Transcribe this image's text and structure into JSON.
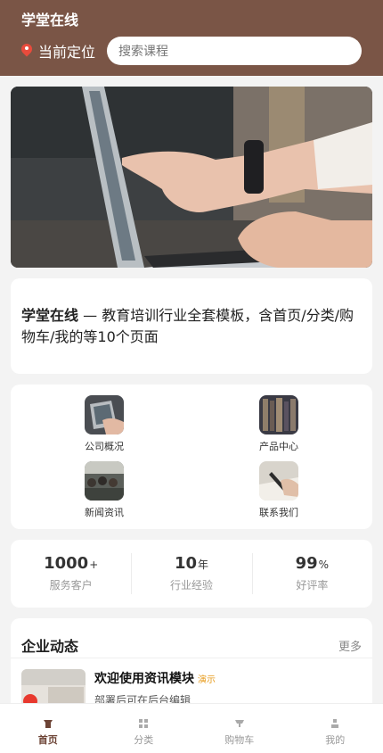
{
  "header": {
    "title": "学堂在线",
    "location_label": "当前定位",
    "search_placeholder": "搜索课程"
  },
  "banner": {
    "icon": "banner-photo-laptop-hands"
  },
  "intro": {
    "brand": "学堂在线",
    "text": " — 教育培训行业全套模板，含首页/分类/购物车/我的等10个页面"
  },
  "grid": {
    "items": [
      {
        "label": "公司概况",
        "icon": "company-overview-icon"
      },
      {
        "label": "产品中心",
        "icon": "product-center-icon"
      },
      {
        "label": "新闻资讯",
        "icon": "news-icon"
      },
      {
        "label": "联系我们",
        "icon": "contact-us-icon"
      }
    ]
  },
  "stats": [
    {
      "num": "1000",
      "unit": "+",
      "label": "服务客户"
    },
    {
      "num": "10",
      "unit": "年",
      "label": "行业经验"
    },
    {
      "num": "99",
      "unit": "%",
      "label": "好评率"
    }
  ],
  "news": {
    "title": "企业动态",
    "more": "更多",
    "item": {
      "title": "欢迎使用资讯模块",
      "tag": "演示",
      "desc": "部署后可在后台编辑"
    }
  },
  "tabs": [
    {
      "label": "首页",
      "active": true
    },
    {
      "label": "分类"
    },
    {
      "label": "购物车"
    },
    {
      "label": "我的"
    }
  ],
  "colors": {
    "brand": "#7a5546",
    "active_tab": "#6d4436",
    "tag": "#e79b1c"
  }
}
